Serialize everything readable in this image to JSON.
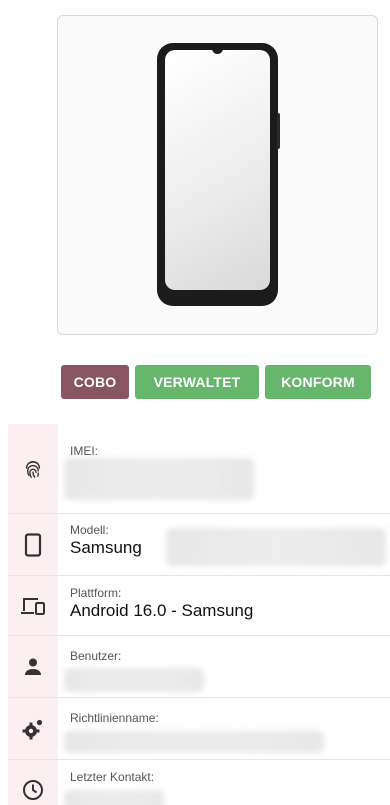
{
  "badges": [
    {
      "label": "COBO",
      "color": "#8a5563"
    },
    {
      "label": "VERWALTET",
      "color": "#66b66b"
    },
    {
      "label": "KONFORM",
      "color": "#66b66b"
    }
  ],
  "details": {
    "imei": {
      "label": "IMEI:",
      "icon": "fingerprint-icon"
    },
    "model": {
      "label": "Modell:",
      "value": "Samsung",
      "icon": "phone-icon"
    },
    "platform": {
      "label": "Plattform:",
      "value": "Android 16.0 - Samsung",
      "icon": "devices-icon"
    },
    "user": {
      "label": "Benutzer:",
      "icon": "person-icon"
    },
    "policy": {
      "label": "Richtlinienname:",
      "icon": "gear-icon"
    },
    "last_contact": {
      "label": "Letzter Kontakt:",
      "icon": "clock-icon"
    }
  },
  "colors": {
    "accent_cobo": "#8a5563",
    "accent_success": "#66b66b",
    "icon_column_bg": "#fbeff1"
  }
}
